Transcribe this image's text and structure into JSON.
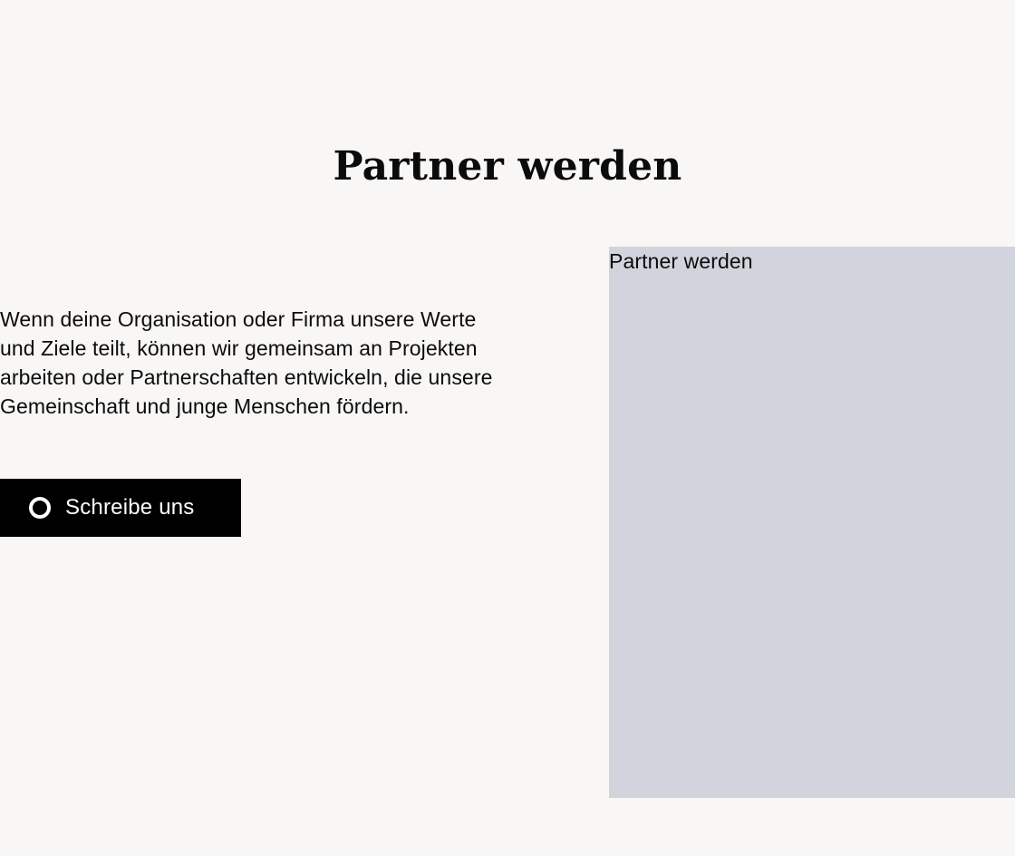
{
  "section": {
    "title": "Partner werden",
    "description": "Wenn deine Organisation oder Firma unsere Werte und Ziele teilt, können wir gemeinsam an Projekten arbeiten oder Partnerschaften entwickeln, die unsere Gemeinschaft und junge Menschen fördern.",
    "cta": {
      "label": "Schreibe uns",
      "icon": "ring-icon"
    }
  },
  "image": {
    "alt_text": "Partner werden",
    "placeholder_color": "#d1d4dd"
  },
  "colors": {
    "background": "#f8f7f5",
    "text": "#0b0b0b",
    "button_background": "#000000",
    "button_text": "#ffffff"
  }
}
